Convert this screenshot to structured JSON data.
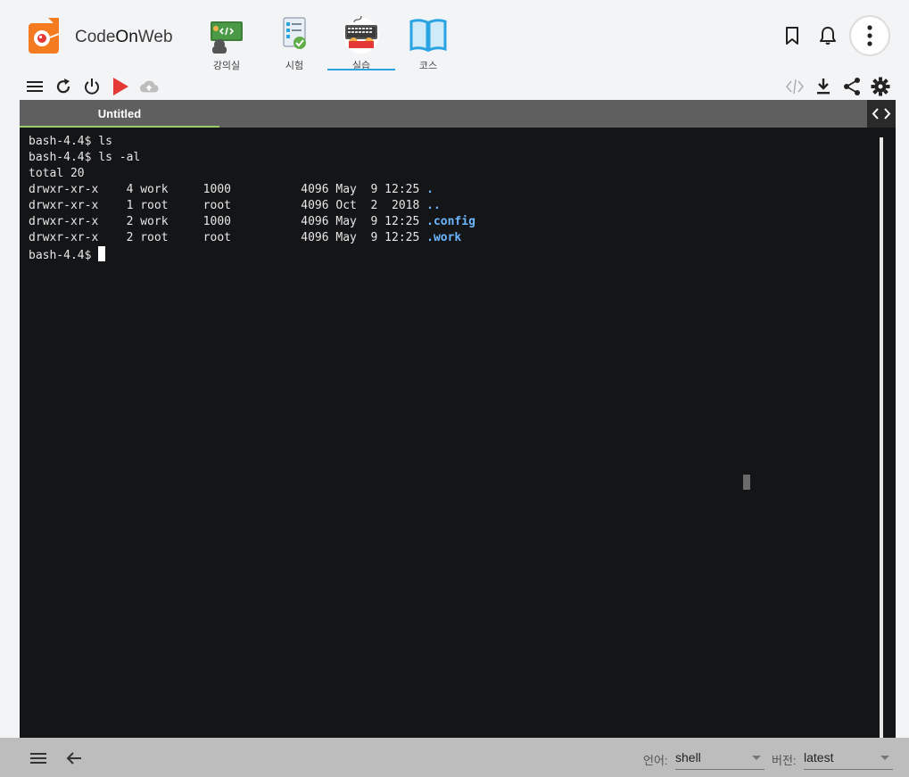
{
  "app": {
    "brand_pre": "Code",
    "brand_mid": "On",
    "brand_post": "Web"
  },
  "nav": [
    {
      "label": "강의실",
      "icon": "lecture-room-icon"
    },
    {
      "label": "시험",
      "icon": "exam-icon"
    },
    {
      "label": "실습",
      "icon": "practice-icon",
      "active": true
    },
    {
      "label": "코스",
      "icon": "course-book-icon"
    }
  ],
  "editor": {
    "tab_title": "Untitled",
    "terminal": [
      {
        "text": "bash-4.4$ ls"
      },
      {
        "text": "bash-4.4$ ls -al"
      },
      {
        "text": "total 20"
      },
      {
        "text": "drwxr-xr-x    4 work     1000          4096 May  9 12:25 ",
        "dir": "."
      },
      {
        "text": "drwxr-xr-x    1 root     root          4096 Oct  2  2018 ",
        "dir": ".."
      },
      {
        "text": "drwxr-xr-x    2 work     1000          4096 May  9 12:25 ",
        "dir": ".config"
      },
      {
        "text": "drwxr-xr-x    2 root     root          4096 May  9 12:25 ",
        "dir": ".work"
      },
      {
        "text": "bash-4.4$ ",
        "cursor": true
      }
    ]
  },
  "statusbar": {
    "language_label": "언어:",
    "language_value": "shell",
    "version_label": "버전:",
    "version_value": "latest"
  },
  "colors": {
    "accent": "#29a3e2",
    "run": "#e53935",
    "terminal_bg": "#141517",
    "dir_text": "#6cb6ff",
    "tab_indicator": "#9ccc65"
  }
}
